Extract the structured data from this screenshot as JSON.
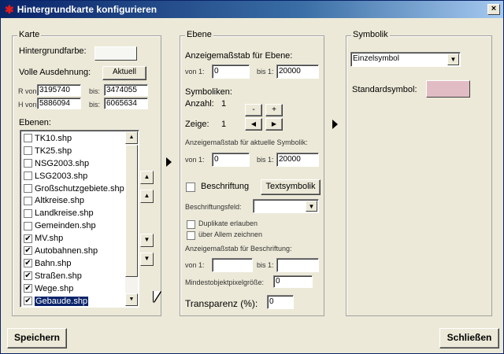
{
  "window": {
    "title": "Hintergrundkarte konfigurieren",
    "close_glyph": "×"
  },
  "karte": {
    "title": "Karte",
    "background_label": "Hintergrundfarbe:",
    "background_color": "#f6f6f2",
    "extent_label": "Volle Ausdehnung:",
    "aktuell_label": "Aktuell",
    "r_von_label": "R von:",
    "r_von": "3195740",
    "r_bis_label": "bis:",
    "r_bis": "3474055",
    "h_von_label": "H von:",
    "h_von": "5886094",
    "h_bis_label": "bis:",
    "h_bis": "6065634",
    "layers_label": "Ebenen:",
    "layers": [
      {
        "name": "TK10.shp",
        "checked": false,
        "selected": false
      },
      {
        "name": "TK25.shp",
        "checked": false,
        "selected": false
      },
      {
        "name": "NSG2003.shp",
        "checked": false,
        "selected": false
      },
      {
        "name": "LSG2003.shp",
        "checked": false,
        "selected": false
      },
      {
        "name": "Großschutzgebiete.shp",
        "checked": false,
        "selected": false
      },
      {
        "name": "Altkreise.shp",
        "checked": false,
        "selected": false
      },
      {
        "name": "Landkreise.shp",
        "checked": false,
        "selected": false
      },
      {
        "name": "Gemeinden.shp",
        "checked": false,
        "selected": false
      },
      {
        "name": "MV.shp",
        "checked": true,
        "selected": false
      },
      {
        "name": "Autobahnen.shp",
        "checked": true,
        "selected": false
      },
      {
        "name": "Bahn.shp",
        "checked": true,
        "selected": false
      },
      {
        "name": "Straßen.shp",
        "checked": true,
        "selected": false
      },
      {
        "name": "Wege.shp",
        "checked": true,
        "selected": false
      },
      {
        "name": "Gebaude.shp",
        "checked": true,
        "selected": true
      }
    ]
  },
  "ebene": {
    "title": "Ebene",
    "scale_label": "Anzeigemaßstab für Ebene:",
    "von_label": "von 1:",
    "von": "0",
    "bis_label": "bis 1:",
    "bis": "20000",
    "symbols_label": "Symboliken:",
    "count_label": "Anzahl:",
    "count": "1",
    "minus": "-",
    "plus": "+",
    "show_label": "Zeige:",
    "show": "1",
    "sym_scale_label": "Anzeigemaßstab für aktuelle Symbolik:",
    "sym_von_label": "von 1:",
    "sym_von": "0",
    "sym_bis_label": "bis 1:",
    "sym_bis": "20000",
    "labeling_label": "Beschriftung",
    "text_symbology_label": "Textsymbolik",
    "label_field_label": "Beschriftungsfeld:",
    "label_field_value": "",
    "duplicates_label": "Duplikate erlauben",
    "above_all_label": "über Allem zeichnen",
    "label_scale_label": "Anzeigemaßstab für Beschriftung:",
    "lbl_von_label": "von 1:",
    "lbl_von": "",
    "lbl_bis_label": "bis 1:",
    "lbl_bis": "",
    "min_pixel_label": "Mindestobjektpixelgröße:",
    "min_pixel": "0",
    "transparency_label": "Transparenz (%):",
    "transparency": "0"
  },
  "symbolik": {
    "title": "Symbolik",
    "type_value": "Einzelsymbol",
    "standard_label": "Standardsymbol:",
    "standard_color": "#e2bcc4"
  },
  "footer": {
    "save_label": "Speichern",
    "close_label": "Schließen"
  }
}
